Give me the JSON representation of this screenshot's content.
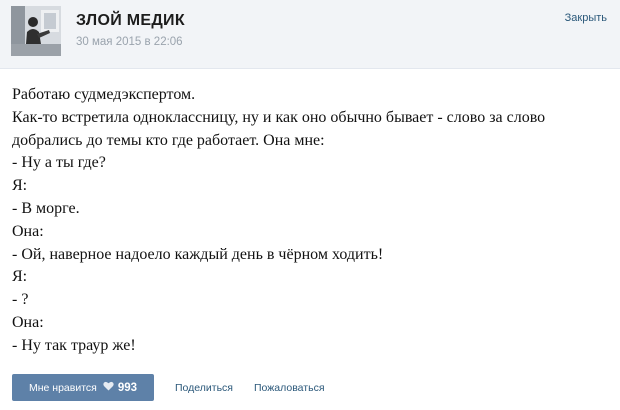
{
  "header": {
    "group_name": "ЗЛОЙ МЕДИК",
    "date": "30 мая 2015 в 22:06",
    "close_label": "Закрыть"
  },
  "post": {
    "lines": [
      "Работаю судмедэкспертом.",
      "Как-то встретила одноклассницу, ну и как оно обычно бывает - слово за слово",
      "добрались до темы кто где работает. Она мне:",
      "- Ну а ты где?",
      "Я:",
      "- В морге.",
      "Она:",
      "- Ой, наверное надоело каждый день в чёрном ходить!",
      "Я:",
      "- ?",
      "Она:",
      "- Ну так траур же!"
    ]
  },
  "actions": {
    "like_label": "Мне нравится",
    "like_count": "993",
    "share_label": "Поделиться",
    "report_label": "Пожаловаться"
  },
  "colors": {
    "accent": "#5e81a8",
    "link": "#2b587a",
    "header_bg": "#f2f4f7",
    "date_text": "#9aa3ad"
  },
  "icons": {
    "like": "heart-icon"
  }
}
